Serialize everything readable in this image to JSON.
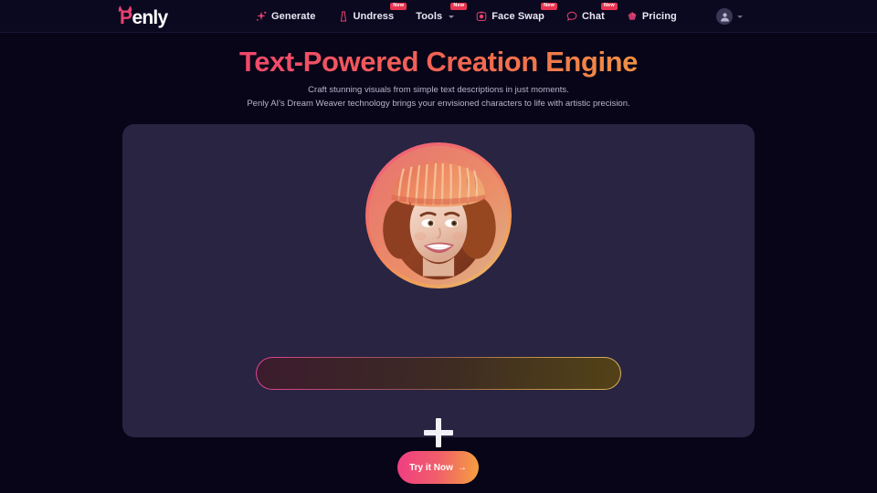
{
  "brand": {
    "logo_p": "P",
    "logo_rest": "enly",
    "logo_icon": "devil-horns-icon"
  },
  "header": {
    "nav": [
      {
        "label": "Generate",
        "icon": "sparkle-icon",
        "badge": ""
      },
      {
        "label": "Undress",
        "icon": "dress-icon",
        "badge": "New"
      },
      {
        "label": "Tools",
        "icon": "",
        "badge": "New",
        "has_chevron": true
      },
      {
        "label": "Face Swap",
        "icon": "face-swap-icon",
        "badge": "New"
      },
      {
        "label": "Chat",
        "icon": "chat-bubble-icon",
        "badge": "New"
      },
      {
        "label": "Pricing",
        "icon": "gem-icon",
        "badge": ""
      }
    ],
    "account": {
      "avatar_icon": "user-avatar-icon",
      "chevron_icon": "chevron-down-icon"
    }
  },
  "hero": {
    "title": "Text-Powered Creation Engine",
    "subtitle_line1": "Craft stunning visuals from simple text descriptions in just moments.",
    "subtitle_line2": "Penly AI's Dream Weaver technology brings your envisioned characters to life with artistic precision."
  },
  "card": {
    "portrait_alt": "smiling-woman-with-auburn-hair-and-knit-beanie",
    "plus_icon": "plus-icon",
    "prompt": {
      "value": "",
      "placeholder": ""
    }
  },
  "cta": {
    "label": "Try it Now",
    "arrow": "→"
  },
  "colors": {
    "page_background": "#070517",
    "header_background": "#0b0920",
    "card_background": "#282442",
    "accent_pink": "#ef3d82",
    "accent_orange": "#f4a13f",
    "badge_red": "#e8344f",
    "logo_pink": "#e8416e"
  }
}
